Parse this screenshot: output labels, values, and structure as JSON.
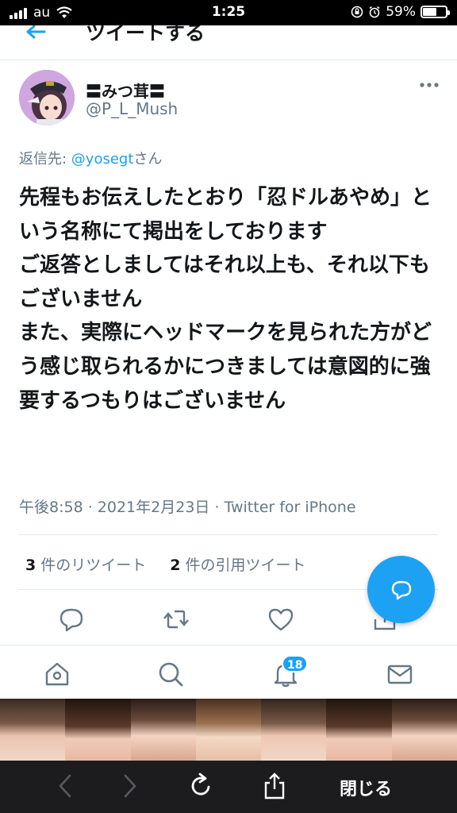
{
  "status_bar": {
    "carrier": "au",
    "time": "1:25",
    "battery": "59%",
    "battery_level": 0.59
  },
  "header": {
    "title": "ツイートする"
  },
  "author": {
    "name": "〓みつ茸〓",
    "handle": "@P_L_Mush"
  },
  "reply": {
    "prefix": "返信先: ",
    "mention": "@yosegt",
    "suffix": "さん"
  },
  "tweet": {
    "text": "先程もお伝えしたとおり「忍ドルあやめ」という名称にて掲出をしております\nご返答としましてはそれ以上も、それ以下もございません\nまた、実際にヘッドマークを見られた方がどう感じ取られるかにつきましては意図的に強要するつもりはございません",
    "meta": "午後8:58 · 2021年2月23日 · Twitter for iPhone"
  },
  "stats": {
    "retweets_count": "3",
    "retweets_label": " 件のリツイート",
    "quotes_count": "2",
    "quotes_label": " 件の引用ツイート"
  },
  "tabbar": {
    "notifications_badge": "18"
  },
  "toolbar": {
    "close_label": "閉じる"
  },
  "colors": {
    "accent": "#1da1f2",
    "text": "#14171a",
    "secondary": "#657786"
  },
  "icons": [
    "back-arrow-icon",
    "more-icon",
    "reply-icon",
    "retweet-icon",
    "like-icon",
    "share-icon",
    "compose-reply-icon",
    "home-icon",
    "search-icon",
    "bell-icon",
    "mail-icon",
    "browser-back-icon",
    "browser-forward-icon",
    "reload-icon",
    "share-sheet-icon"
  ]
}
